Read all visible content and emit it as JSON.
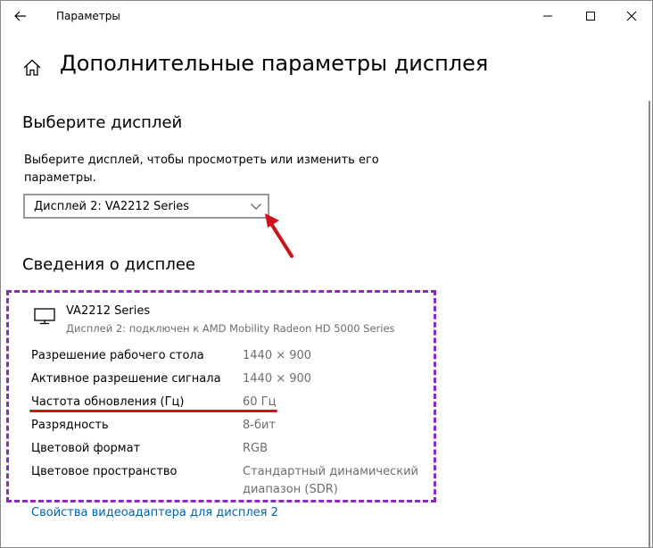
{
  "window": {
    "title": "Параметры"
  },
  "page": {
    "title": "Дополнительные параметры дисплея"
  },
  "select_display": {
    "heading": "Выберите дисплей",
    "description": "Выберите дисплей, чтобы просмотреть или изменить его параметры.",
    "selected": "Дисплей 2: VA2212 Series"
  },
  "display_info": {
    "heading": "Сведения о дисплее",
    "monitor_name": "VA2212 Series",
    "monitor_subtitle": "Дисплей 2: подключен к AMD Mobility Radeon HD 5000 Series",
    "rows": [
      {
        "label": "Разрешение рабочего стола",
        "value": "1440 × 900"
      },
      {
        "label": "Активное разрешение сигнала",
        "value": "1440 × 900"
      },
      {
        "label": "Частота обновления (Гц)",
        "value": "60 Гц"
      },
      {
        "label": "Разрядность",
        "value": "8-бит"
      },
      {
        "label": "Цветовой формат",
        "value": "RGB"
      },
      {
        "label": "Цветовое пространство",
        "value": "Стандартный динамический диапазон (SDR)"
      }
    ]
  },
  "link": {
    "adapter_properties": "Свойства видеоадаптера для дисплея 2"
  },
  "icons": {
    "back": "back-arrow-icon",
    "home": "home-icon",
    "minimize": "minimize-icon",
    "maximize": "maximize-icon",
    "close": "close-icon",
    "chevron": "chevron-down-icon",
    "monitor": "monitor-icon"
  },
  "colors": {
    "link": "#0063b1",
    "annotation_dashed_border": "#8e2bbf",
    "annotation_red": "#d0101a",
    "secondary_text": "#6d6d6d"
  }
}
